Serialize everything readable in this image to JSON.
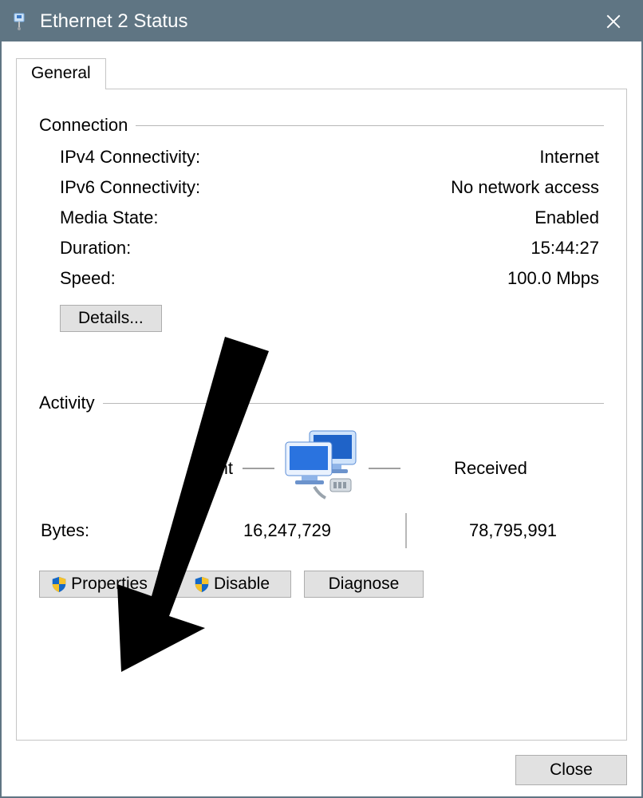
{
  "window": {
    "title": "Ethernet 2 Status"
  },
  "tabs": {
    "general_label": "General"
  },
  "connection": {
    "section_title": "Connection",
    "ipv4_label": "IPv4 Connectivity:",
    "ipv4_value": "Internet",
    "ipv6_label": "IPv6 Connectivity:",
    "ipv6_value": "No network access",
    "media_label": "Media State:",
    "media_value": "Enabled",
    "duration_label": "Duration:",
    "duration_value": "15:44:27",
    "speed_label": "Speed:",
    "speed_value": "100.0 Mbps",
    "details_label": "Details..."
  },
  "activity": {
    "section_title": "Activity",
    "sent_label": "Sent",
    "received_label": "Received",
    "bytes_label": "Bytes:",
    "bytes_sent": "16,247,729",
    "bytes_received": "78,795,991"
  },
  "actions": {
    "properties_label": "Properties",
    "disable_label": "Disable",
    "diagnose_label": "Diagnose"
  },
  "footer": {
    "close_label": "Close"
  }
}
